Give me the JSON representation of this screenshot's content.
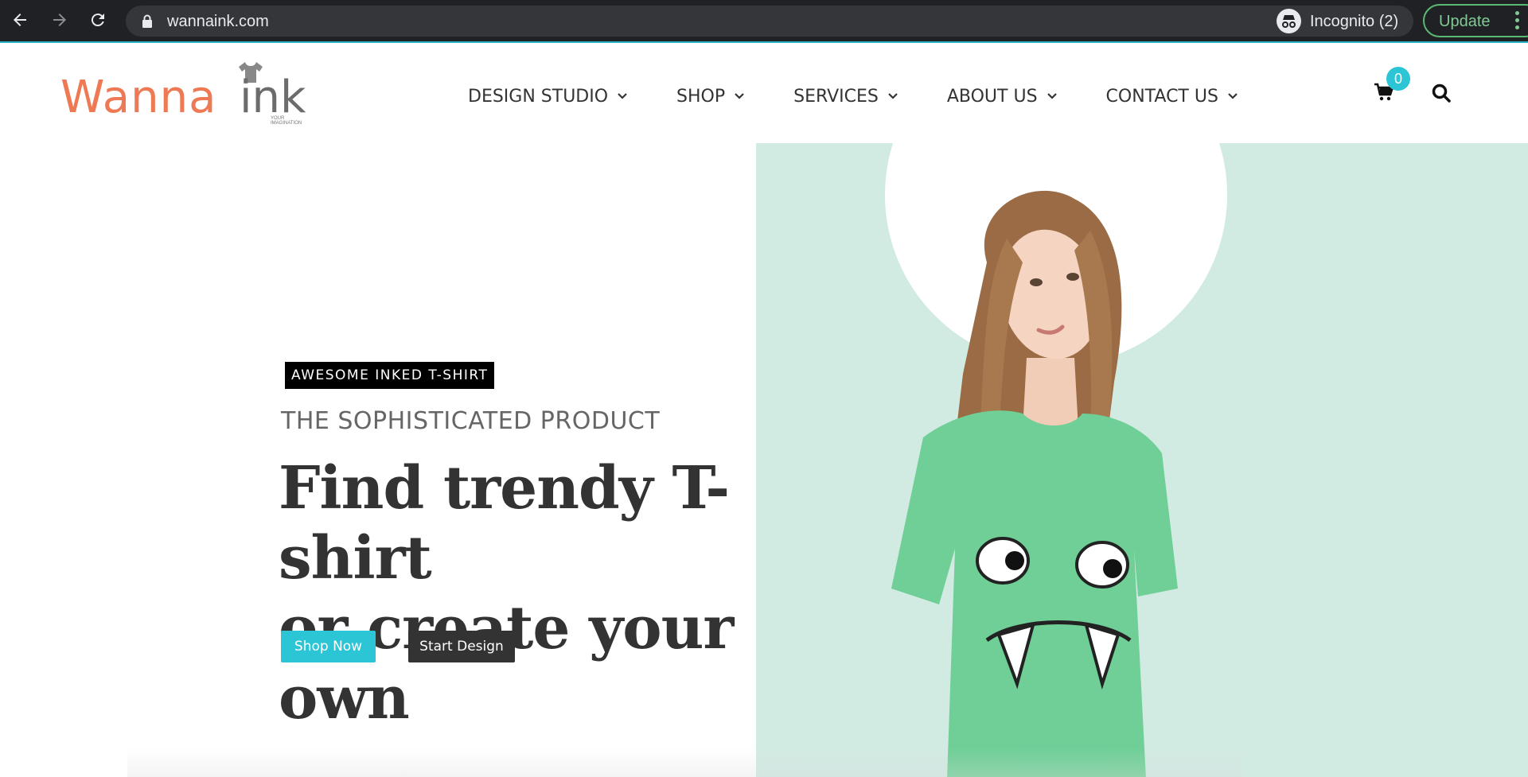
{
  "browser": {
    "url": "wannaink.com",
    "incognito_label": "Incognito (2)",
    "update_label": "Update"
  },
  "logo": {
    "wanna": "Wanna",
    "ink": "ink",
    "tagline": "YOUR IMAGINATION"
  },
  "nav": {
    "items": [
      {
        "label": "DESIGN STUDIO"
      },
      {
        "label": "SHOP"
      },
      {
        "label": "SERVICES"
      },
      {
        "label": "ABOUT US"
      },
      {
        "label": "CONTACT US"
      }
    ],
    "cart_count": "0"
  },
  "hero": {
    "badge": "AWESOME INKED T-SHIRT",
    "subtitle": "THE SOPHISTICATED PRODUCT",
    "headline_line1": "Find trendy T-shirt",
    "headline_line2": "or create your own",
    "shop_button": "Shop Now",
    "design_button": "Start Design"
  },
  "colors": {
    "accent": "#2bc5d5",
    "brand_orange": "#ee7a55",
    "mint": "#d1ebe3",
    "tshirt_green": "#6fcf97"
  }
}
